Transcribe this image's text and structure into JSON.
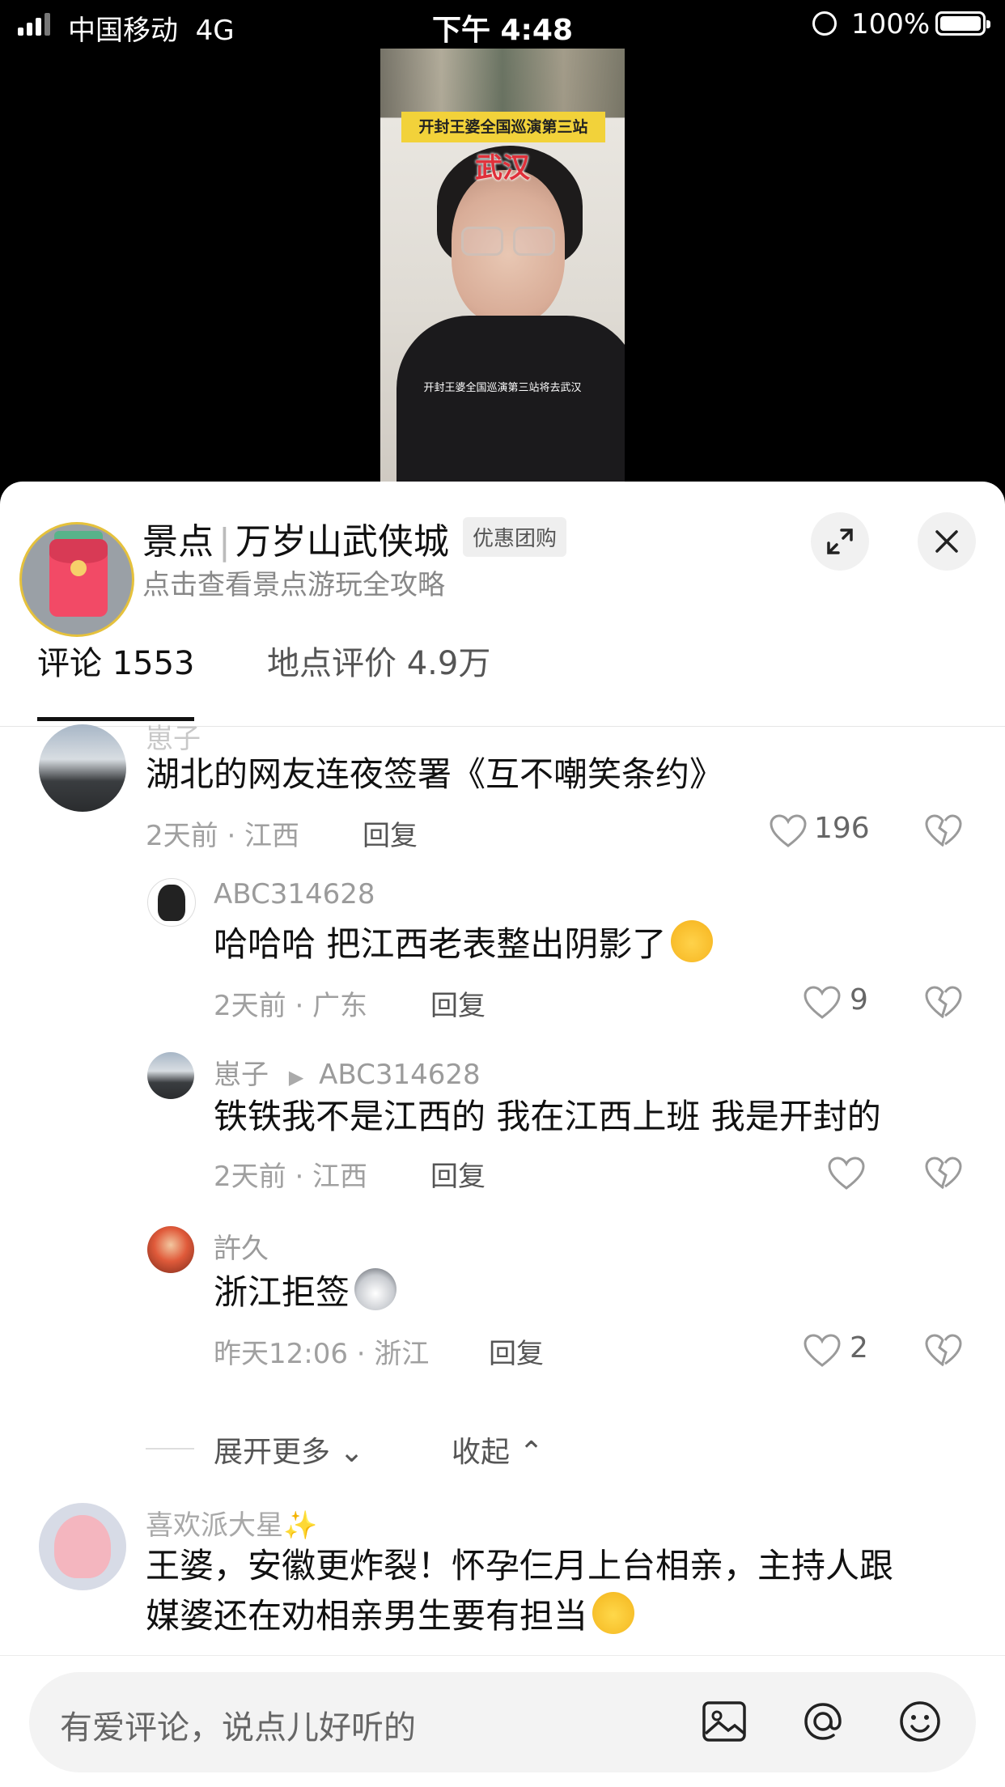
{
  "status_bar": {
    "carrier": "中国移动",
    "network": "4G",
    "time": "下午 4:48",
    "battery": "100%"
  },
  "video": {
    "title_banner": "开封王婆全国巡演第三站",
    "city": "武汉",
    "caption": "开封王婆全国巡演第三站将去武汉"
  },
  "poi": {
    "category": "景点",
    "name": "万岁山武侠城",
    "badge": "优惠团购",
    "subtitle": "点击查看景点游玩全攻略"
  },
  "tabs": [
    {
      "label": "评论 1553"
    },
    {
      "label": "地点评价 4.9万"
    }
  ],
  "comments": [
    {
      "user": "崽子",
      "text": "湖北的网友连夜签署《互不嘲笑条约》",
      "time_loc": "2天前 · 江西",
      "reply": "回复",
      "likes": "196"
    },
    {
      "user": "ABC314628",
      "text": "哈哈哈  把江西老表整出阴影了",
      "emoji": "laughing-crying-emoji",
      "time_loc": "2天前 · 广东",
      "reply": "回复",
      "likes": "9"
    },
    {
      "user": "崽子",
      "reply_to": "ABC314628",
      "text": "铁铁我不是江西的 我在江西上班 我是开封的",
      "time_loc": "2天前 · 江西",
      "reply": "回复",
      "likes": ""
    },
    {
      "user": "許久",
      "text": "浙江拒签",
      "emoji": "husky-emoji",
      "time_loc": "昨天12:06 · 浙江",
      "reply": "回复",
      "likes": "2"
    },
    {
      "user": "喜欢派大星✨",
      "text_line1": "王婆，安徽更炸裂！怀孕仨月上台相亲，主持人跟",
      "text_line2": "媒婆还在劝相亲男生要有担当",
      "emoji": "smile-emoji"
    }
  ],
  "thread_controls": {
    "expand": "展开更多",
    "collapse": "收起"
  },
  "input": {
    "placeholder": "有爱评论，说点儿好听的"
  }
}
